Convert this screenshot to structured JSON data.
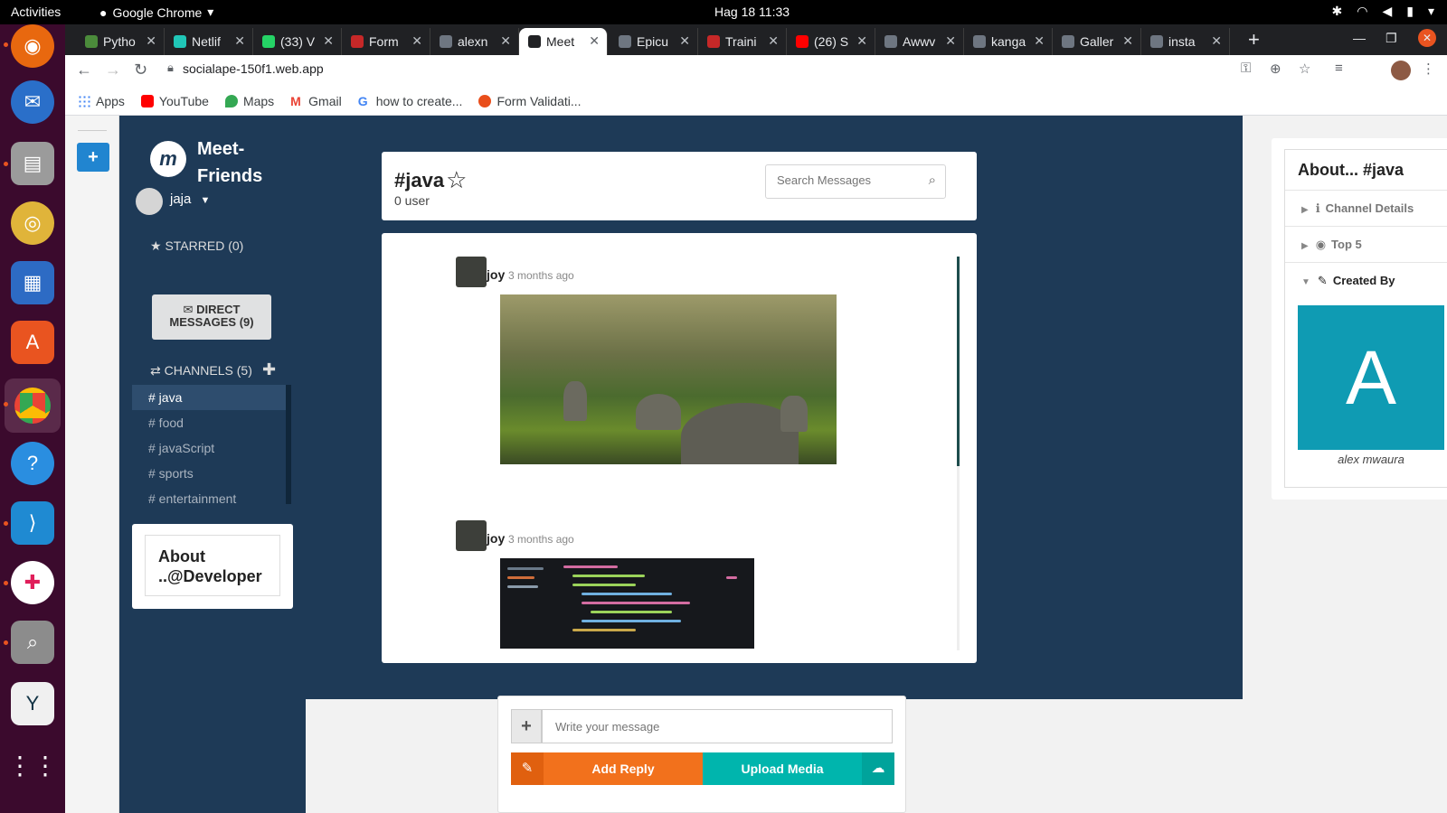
{
  "topbar": {
    "activities": "Activities",
    "app_name": "Google Chrome",
    "clock": "Hag 18  11:33"
  },
  "dock": {
    "items": [
      "firefox-icon",
      "thunderbird-icon",
      "files-icon",
      "rhythmbox-icon",
      "libreoffice-writer-icon",
      "app-center-icon",
      "chrome-icon",
      "help-icon",
      "vscode-icon",
      "slack-icon",
      "image-viewer-icon",
      "shotwell-icon",
      "show-apps-icon"
    ]
  },
  "tabs": [
    {
      "label": "Pytho",
      "color": "#4b8b3b"
    },
    {
      "label": "Netlif",
      "color": "#20c6b7"
    },
    {
      "label": "(33) V",
      "color": "#25d366"
    },
    {
      "label": "Form",
      "color": "#c62828"
    },
    {
      "label": "alexn",
      "color": "#6e7681"
    },
    {
      "label": "Meet",
      "color": "#202124"
    },
    {
      "label": "Epicu",
      "color": "#6e7681"
    },
    {
      "label": "Traini",
      "color": "#c62828"
    },
    {
      "label": "(26) S",
      "color": "#ff0000"
    },
    {
      "label": "Awwv",
      "color": "#6e7681"
    },
    {
      "label": "kanga",
      "color": "#6e7681"
    },
    {
      "label": "Galler",
      "color": "#6e7681"
    },
    {
      "label": "insta",
      "color": "#6e7681"
    }
  ],
  "address": {
    "url": "socialape-150f1.web.app"
  },
  "bookmarks": [
    {
      "label": "Apps",
      "color": "#4285f4"
    },
    {
      "label": "YouTube",
      "color": "#ff0000"
    },
    {
      "label": "Maps",
      "color": "#34a853"
    },
    {
      "label": "Gmail",
      "color": "#ea4335"
    },
    {
      "label": "how to create...",
      "color": "#4285f4"
    },
    {
      "label": "Form Validati...",
      "color": "#e94e1b"
    }
  ],
  "sidebar": {
    "brand_line1": "Meet-",
    "brand_line2": "Friends",
    "logo_letter": "m",
    "username": "jaja",
    "starred": "STARRED (0)",
    "dm_line1": "DIRECT",
    "dm_line2": "MESSAGES (9)",
    "channels_header": "CHANNELS (5)",
    "channels": [
      "# java",
      "# food",
      "# javaScript",
      "# sports",
      "# entertainment"
    ],
    "about_dev_line1": "About",
    "about_dev_line2": "..@Developer"
  },
  "channel": {
    "title": "#java",
    "users": "0 user",
    "search_placeholder": "Search Messages"
  },
  "messages": [
    {
      "author": "joy",
      "time": "3 months ago"
    },
    {
      "author": "joy",
      "time": "3 months ago"
    }
  ],
  "about_panel": {
    "title": "About... #java",
    "sections": [
      "Channel Details",
      "Top 5",
      "Created By"
    ],
    "creator_initial": "A",
    "creator_name": "alex mwaura"
  },
  "composer": {
    "placeholder": "Write your message",
    "reply_label": "Add Reply",
    "upload_label": "Upload Media"
  },
  "colors": {
    "main_bg": "#1e3a57",
    "reply": "#f2711c",
    "upload": "#00b5ad",
    "creator_tile": "#0f9bb3",
    "add_button": "#2185d0"
  }
}
